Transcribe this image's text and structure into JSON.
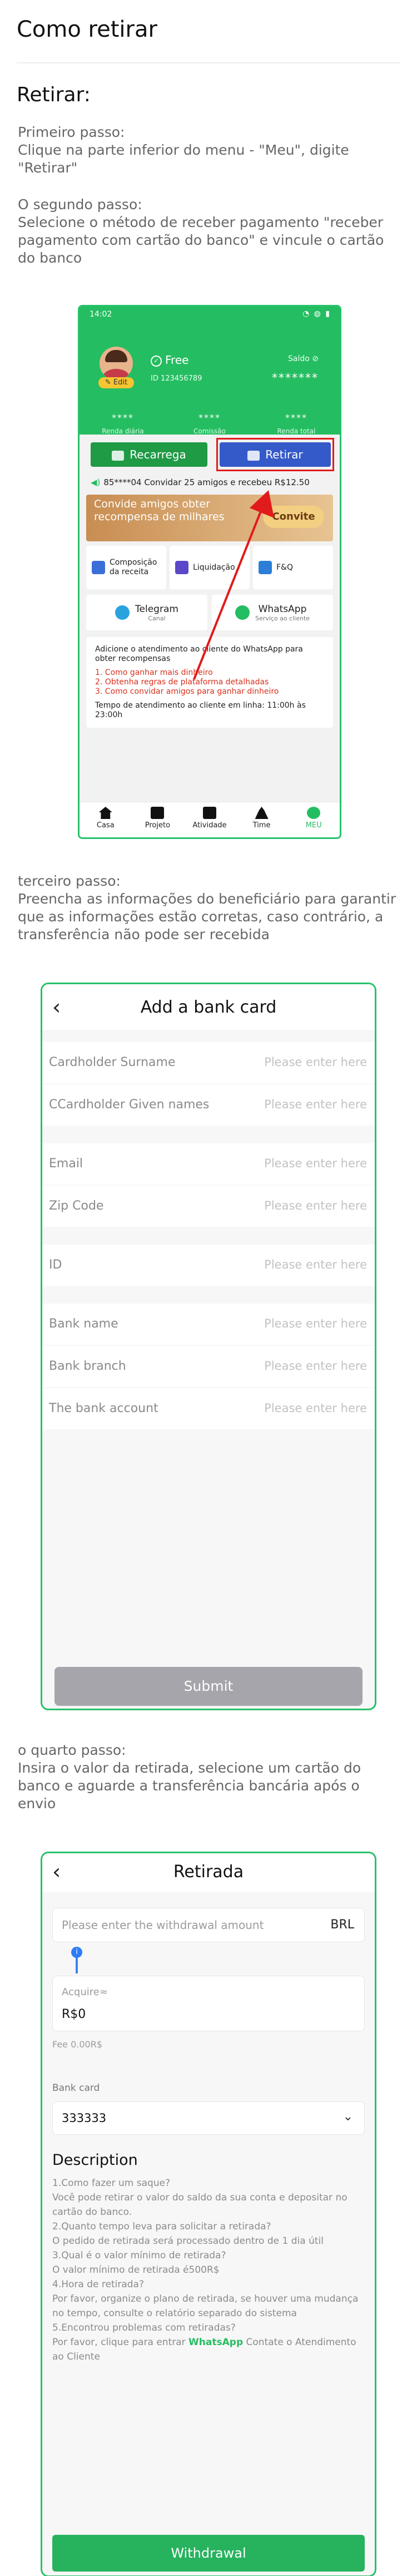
{
  "page": {
    "title": "Como retirar",
    "section_heading": "Retirar:",
    "step1": "Primeiro passo:\nClique na parte inferior do menu - \"Meu\", digite \"Retirar\"",
    "step2": "O segundo passo:\nSelecione o método de receber pagamento \"receber pagamento com cartão do banco\" e vincule o cartão do banco",
    "step3": "terceiro passo:\nPreencha as informações do beneficiário para garantir que as informações estão corretas, caso contrário, a transferência não pode ser recebida",
    "step4": "o quarto passo:\nInsira o valor da retirada, selecione um cartão do banco e aguarde a transferência bancária após o envio"
  },
  "profile_screen": {
    "status_time": "14:02",
    "edit_label": "Edit",
    "level": "Free",
    "user_id": "ID 123456789",
    "saldo_label": "Saldo",
    "saldo_value": "*******",
    "stats": [
      {
        "value": "****",
        "label": "Renda diária"
      },
      {
        "value": "****",
        "label": "Comissão"
      },
      {
        "value": "****",
        "label": "Renda total"
      }
    ],
    "recarrega_label": "Recarrega",
    "retirar_label": "Retirar",
    "ticker": "85****04 Convidar 25 amigos e recebeu R$12.50",
    "invite_text": "Convide amigos obter recompensa de milhares",
    "invite_button": "Convite",
    "menu": [
      {
        "label": "Composição da receita",
        "color": "#3b6fd8"
      },
      {
        "label": "Liquidação",
        "color": "#5a48c8"
      },
      {
        "label": "F&Q",
        "color": "#2c7ed6"
      }
    ],
    "telegram_label": "Telegram",
    "telegram_sub": "Canal",
    "whatsapp_label": "WhatsApp",
    "whatsapp_sub": "Serviço ao cliente",
    "wa_title": "Adicione o atendimento ao cliente do WhatsApp para obter recompensas",
    "wa_items": [
      "1. Como ganhar mais dinheiro",
      "2. Obtenha regras de plataforma detalhadas",
      "3. Como convidar amigos para ganhar dinheiro"
    ],
    "wa_hours": "Tempo de atendimento ao cliente em linha: 11:00h às 23:00h",
    "tabs": [
      "Casa",
      "Projeto",
      "Atividade",
      "Time",
      "MEU"
    ]
  },
  "bank_card_screen": {
    "title": "Add a bank card",
    "placeholder": "Please enter here",
    "fields": [
      "Cardholder Surname",
      "CCardholder Given names",
      "Email",
      "Zip Code",
      "ID",
      "Bank name",
      "Bank branch",
      "The bank account"
    ],
    "submit_label": "Submit"
  },
  "withdraw_screen": {
    "title": "Retirada",
    "amount_placeholder": "Please enter the withdrawal amount",
    "currency": "BRL",
    "slider_marker": "i",
    "receive_label": "Acquire≈",
    "receive_value": "R$0",
    "fee": "Fee 0.00R$",
    "bank_card_label": "Bank card",
    "bank_card_value": "333333",
    "description_heading": "Description",
    "description_lines": [
      "1.Como fazer um saque?",
      "Você pode retirar o valor do saldo da sua conta e depositar no cartão do banco.",
      "2.Quanto tempo leva para solicitar a retirada?",
      "O pedido de retirada será processado dentro de 1 dia útil",
      "3.Qual é o valor mínimo de retirada?",
      "O valor mínimo de retirada é500R$",
      "4.Hora de retirada?",
      "Por favor, organize o plano de retirada, se houver uma mudança no tempo, consulte o relatório separado do sistema",
      "5.Encontrou problemas com retiradas?"
    ],
    "description_last_prefix": "Por favor, clique para entrar ",
    "description_last_link": "WhatsApp",
    "description_last_suffix": " Contate o Atendimento ao Cliente",
    "withdraw_label": "Withdrawal"
  },
  "colors": {
    "accent_green": "#25bd61",
    "retirar_blue": "#3459c9",
    "highlight_red": "#e11b1b"
  }
}
